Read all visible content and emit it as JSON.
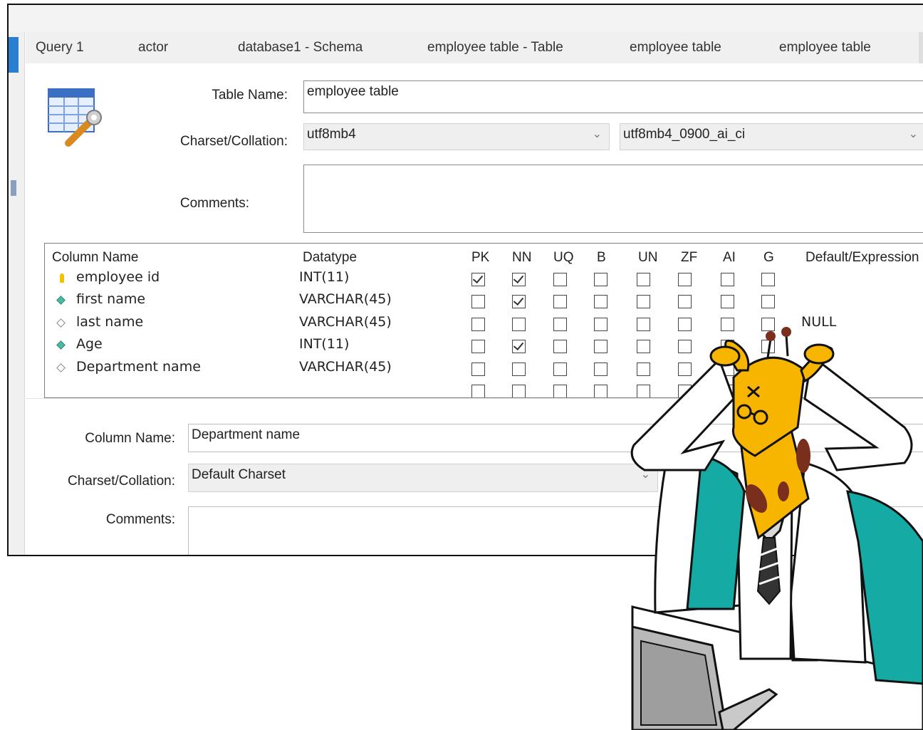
{
  "tabs": [
    "Query 1",
    "actor",
    "database1 - Schema",
    "employee table - Table",
    "employee table",
    "employee table"
  ],
  "table": {
    "name_label": "Table Name:",
    "name_value": "employee table",
    "charset_label": "Charset/Collation:",
    "charset_value": "utf8mb4",
    "collation_value": "utf8mb4_0900_ai_ci",
    "comments_label": "Comments:"
  },
  "grid": {
    "headers": [
      "Column Name",
      "Datatype",
      "PK",
      "NN",
      "UQ",
      "B",
      "UN",
      "ZF",
      "AI",
      "G",
      "Default/Expression"
    ],
    "rows": [
      {
        "name": "employee id",
        "type": "INT(11)",
        "icon": "primary-key-icon",
        "pk": true,
        "nn": true,
        "default": ""
      },
      {
        "name": "first name",
        "type": "VARCHAR(45)",
        "icon": "column-filled-icon",
        "pk": false,
        "nn": true,
        "default": ""
      },
      {
        "name": "last name",
        "type": "VARCHAR(45)",
        "icon": "column-empty-icon",
        "pk": false,
        "nn": false,
        "default": "NULL"
      },
      {
        "name": "Age",
        "type": "INT(11)",
        "icon": "column-filled-icon",
        "pk": false,
        "nn": true,
        "default": ""
      },
      {
        "name": "Department name",
        "type": "VARCHAR(45)",
        "icon": "column-empty-icon",
        "pk": false,
        "nn": false,
        "default": ""
      }
    ]
  },
  "column": {
    "name_label": "Column Name:",
    "name_value": "Department name",
    "charset_label": "Charset/Collation:",
    "charset_value": "Default Charset",
    "comments_label": "Comments:"
  },
  "colors": {
    "accent": "#2a7fd1",
    "giraffe": "#f7b500",
    "teal": "#16aaa5"
  }
}
